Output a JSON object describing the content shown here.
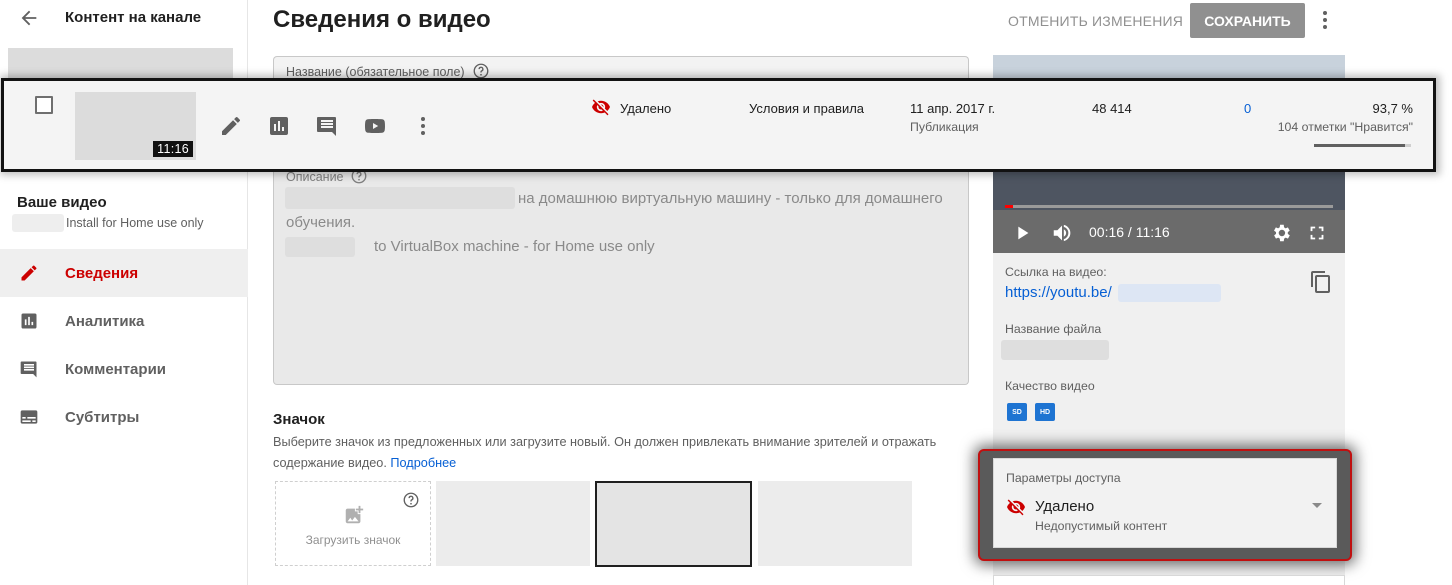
{
  "sidebar": {
    "title": "Контент на канале",
    "your_video_label": "Ваше видео",
    "your_video_subtitle": "Install for Home use only",
    "nav": [
      {
        "label": "Сведения",
        "icon": "pencil-icon",
        "active": true
      },
      {
        "label": "Аналитика",
        "icon": "analytics-icon",
        "active": false
      },
      {
        "label": "Комментарии",
        "icon": "comments-icon",
        "active": false
      },
      {
        "label": "Субтитры",
        "icon": "subtitles-icon",
        "active": false
      }
    ]
  },
  "header": {
    "title": "Сведения о видео",
    "discard_label": "ОТМЕНИТЬ ИЗМЕНЕНИЯ",
    "save_label": "СОХРАНИТЬ"
  },
  "form": {
    "title_label": "Название (обязательное поле)",
    "description_label": "Описание",
    "description_lines": [
      "на домашнюю виртуальную машину - только для домашнего",
      "обучения.",
      "to VirtualBox machine -  for Home use only"
    ]
  },
  "thumbnail": {
    "heading": "Значок",
    "description": "Выберите значок из предложенных или загрузите новый. Он должен привлекать внимание зрителей и отражать содержание видео.",
    "more_link": "Подробнее",
    "upload_label": "Загрузить значок"
  },
  "video_panel": {
    "time": "00:16 / 11:16",
    "progress_fraction": 0.024,
    "link_label": "Ссылка на видео:",
    "link_text": "https://youtu.be/",
    "filename_label": "Название файла",
    "quality_label": "Качество видео",
    "quality_badges": [
      "SD",
      "HD"
    ]
  },
  "access": {
    "label": "Параметры доступа",
    "value": "Удалено",
    "sub": "Недопустимый контент"
  },
  "row": {
    "duration": "11:16",
    "visibility": "Удалено",
    "restrictions": "Условия и правила",
    "date": "11 апр. 2017 г.",
    "date_sub": "Публикация",
    "views": "48 414",
    "comments": "0",
    "likes_pct": "93,7 %",
    "likes_sub": "104 отметки \"Нравится\"",
    "likes_fraction": 0.937
  },
  "colors": {
    "accent_red": "#cc0000",
    "link_blue": "#065fd4",
    "save_button_bg": "#909090",
    "highlight_border": "#c01010"
  }
}
